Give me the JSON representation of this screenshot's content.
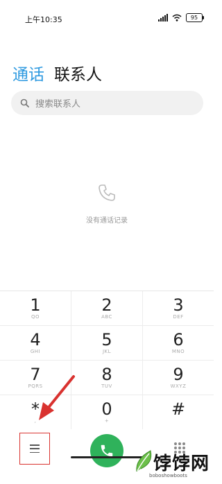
{
  "status_bar": {
    "time": "上午10:35",
    "battery": "95"
  },
  "tabs": [
    {
      "label": "通话",
      "active": true
    },
    {
      "label": "联系人",
      "active": false
    }
  ],
  "search": {
    "placeholder": "搜索联系人"
  },
  "empty_state": {
    "text": "没有通话记录",
    "icon": "phone-outline-icon"
  },
  "keypad": [
    [
      {
        "digit": "1",
        "letters": "QO"
      },
      {
        "digit": "2",
        "letters": "ABC"
      },
      {
        "digit": "3",
        "letters": "DEF"
      }
    ],
    [
      {
        "digit": "4",
        "letters": "GHI"
      },
      {
        "digit": "5",
        "letters": "JKL"
      },
      {
        "digit": "6",
        "letters": "MNO"
      }
    ],
    [
      {
        "digit": "7",
        "letters": "PQRS"
      },
      {
        "digit": "8",
        "letters": "TUV"
      },
      {
        "digit": "9",
        "letters": "WXYZ"
      }
    ],
    [
      {
        "digit": "*",
        "letters": ","
      },
      {
        "digit": "0",
        "letters": "+"
      },
      {
        "digit": "#",
        "letters": ""
      }
    ]
  ],
  "bottom_bar": {
    "menu_icon": "menu-icon",
    "call_icon": "phone-icon",
    "dialpad_icon": "dialpad-icon"
  },
  "watermark": {
    "text": "饽饽网",
    "sub": "boboshowboots"
  },
  "colors": {
    "accent": "#2f9ae0",
    "call_green": "#2fb25b",
    "highlight_red": "#d9322f"
  }
}
